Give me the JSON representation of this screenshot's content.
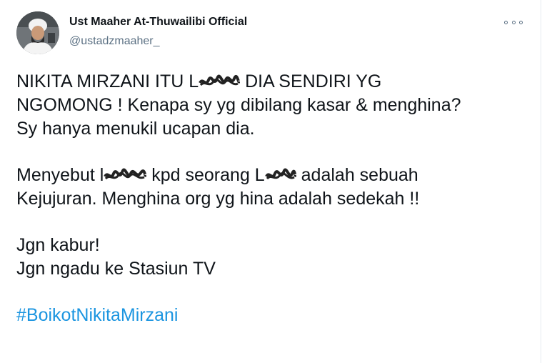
{
  "tweet": {
    "author_name": "Ust Maaher At-Thuwailibi Official",
    "author_handle": "@ustadzmaaher_",
    "more_icon": "more-icon",
    "line1_a": "NIKITA MIRZANI ITU L",
    "line1_b": " DIA SENDIRI YG",
    "line2": "NGOMONG ! Kenapa sy yg dibilang kasar & menghina?",
    "line3": "Sy hanya menukil ucapan dia.",
    "line4_a": "Menyebut l",
    "line4_b": "kpd seorang L",
    "line4_c": " adalah sebuah",
    "line5": "Kejujuran. Menghina org yg hina adalah sedekah !!",
    "line6": "Jgn kabur!",
    "line7": "Jgn ngadu ke Stasiun TV",
    "hashtag": "#BoikotNikitaMirzani",
    "hashtag_color": "#1b95e0"
  }
}
